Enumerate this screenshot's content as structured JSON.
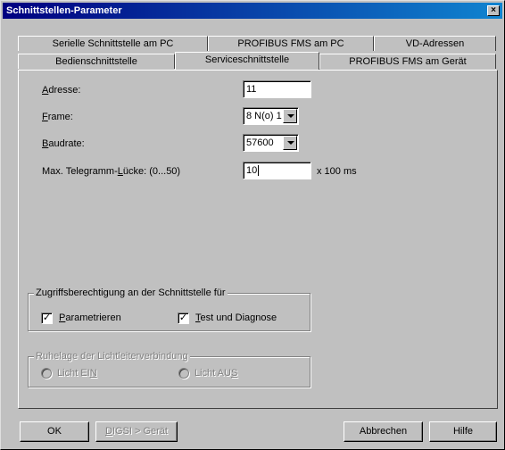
{
  "window": {
    "title": "Schnittstellen-Parameter",
    "close_glyph": "×"
  },
  "tabs_back": [
    {
      "label": "Serielle Schnittstelle am PC"
    },
    {
      "label": "PROFIBUS FMS am PC"
    },
    {
      "label": "VD-Adressen"
    }
  ],
  "tabs_front": [
    {
      "label": "Bedienschnittstelle"
    },
    {
      "label": "Serviceschnittstelle",
      "active": true
    },
    {
      "label": "PROFIBUS FMS am Gerät"
    }
  ],
  "form": {
    "adresse": {
      "label_pre": "",
      "label_mnemonic": "A",
      "label_post": "dresse:",
      "value": "11"
    },
    "frame": {
      "label_pre": "",
      "label_mnemonic": "F",
      "label_post": "rame:",
      "value": "8 N(o) 1"
    },
    "baudrate": {
      "label_pre": "",
      "label_mnemonic": "B",
      "label_post": "audrate:",
      "value": "57600"
    },
    "luecke": {
      "label_pre": "Max. Telegramm-",
      "label_mnemonic": "L",
      "label_post": "ücke: (0...50)",
      "value": "10",
      "unit": "x 100 ms"
    }
  },
  "access_group": {
    "title": "Zugriffsberechtigung an der Schnittstelle für",
    "param": {
      "label_pre": "",
      "label_mnemonic": "P",
      "label_post": "arametrieren",
      "checked": true,
      "mark": "✓"
    },
    "test": {
      "label_pre": "",
      "label_mnemonic": "T",
      "label_post": "est und Diagnose",
      "checked": true,
      "mark": "✓"
    }
  },
  "light_group": {
    "title": "Ruhelage der Lichtleiterverbindung",
    "on": {
      "label_pre": "Licht EI",
      "label_mnemonic": "N",
      "label_post": ""
    },
    "off": {
      "label_pre": "Licht AU",
      "label_mnemonic": "S",
      "label_post": ""
    }
  },
  "buttons": {
    "ok": "OK",
    "digsi_pre": "",
    "digsi_mnemonic": "D",
    "digsi_post": "IGSI > Gerät",
    "cancel": "Abbrechen",
    "help": "Hilfe"
  },
  "colors": {
    "titlebar_start": "#000080",
    "titlebar_end": "#1084d0",
    "face": "#c0c0c0"
  }
}
